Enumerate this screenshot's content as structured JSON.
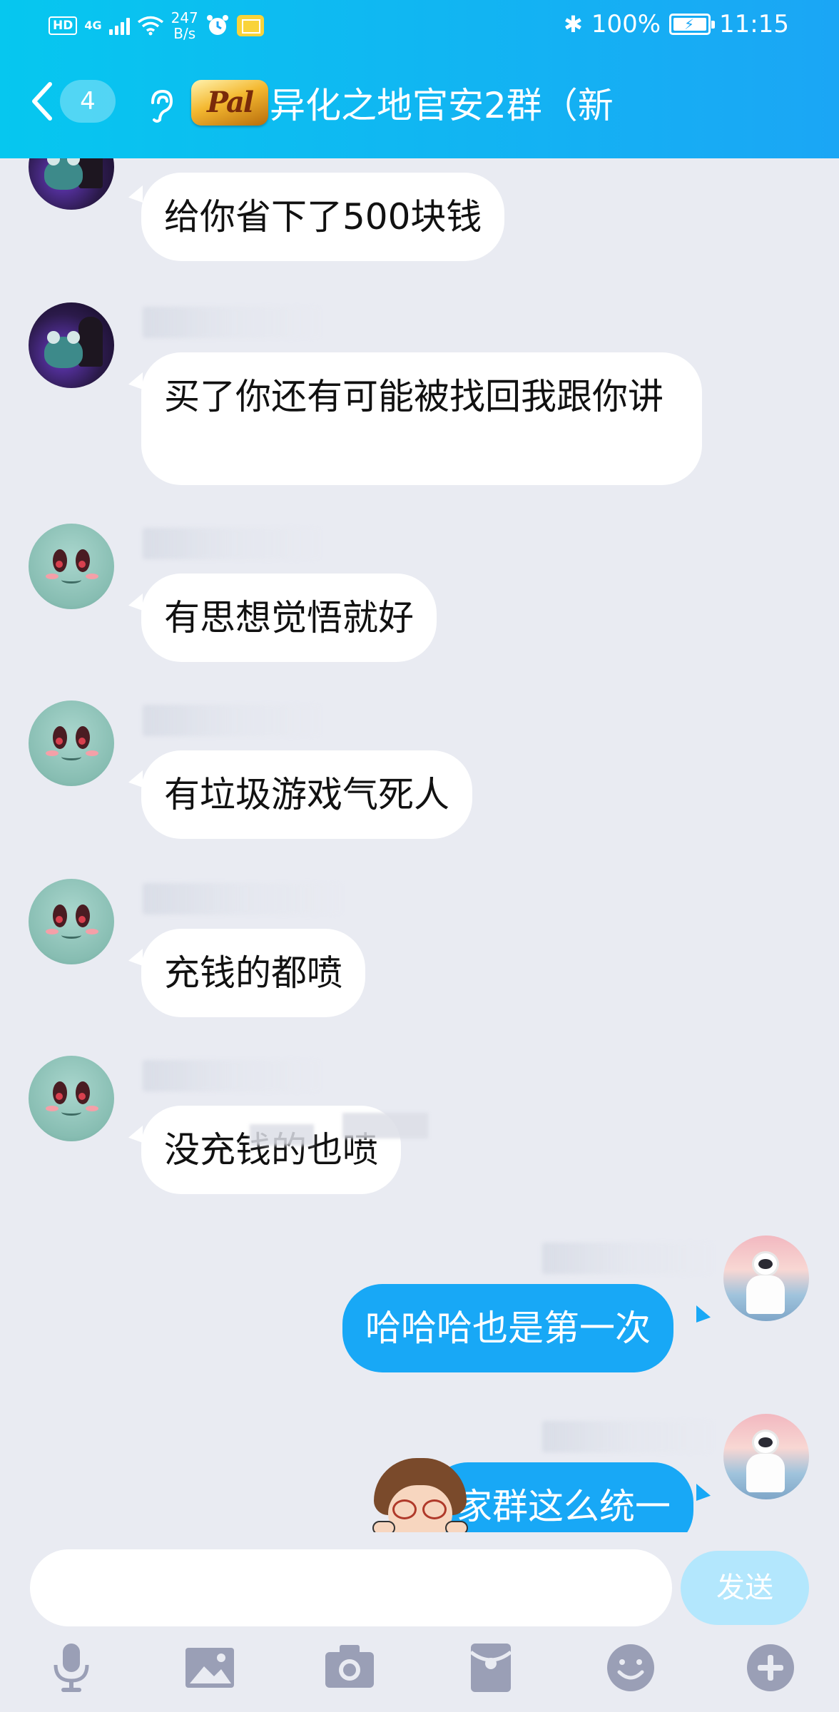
{
  "status_bar": {
    "hd": "HD",
    "net_type": "4G",
    "net_speed_value": "247",
    "net_speed_unit": "B/s",
    "battery_pct": "100%",
    "time": "11:15"
  },
  "nav": {
    "unread_count": "4",
    "group_logo_text": "Pal",
    "group_title": "异化之地官安2群（新"
  },
  "messages": [
    {
      "text": "给你省下了500块钱",
      "from": "other",
      "avatar": "dark-frog-avatar"
    },
    {
      "text": "买了你还有可能被找回我跟你讲",
      "from": "other",
      "avatar": "dark-frog-avatar"
    },
    {
      "text": "有思想觉悟就好",
      "from": "other",
      "avatar": "squirtle-avatar"
    },
    {
      "text": "有垃圾游戏气死人",
      "from": "other",
      "avatar": "squirtle-avatar"
    },
    {
      "text": "充钱的都喷",
      "from": "other",
      "avatar": "squirtle-avatar"
    },
    {
      "text": "没充钱的也喷",
      "from": "other",
      "avatar": "squirtle-avatar"
    },
    {
      "text": "哈哈哈也是第一次",
      "from": "self",
      "avatar": "astronaut-avatar"
    },
    {
      "text": "家群这么统一",
      "from": "self",
      "avatar": "astronaut-avatar"
    }
  ],
  "input": {
    "value": "",
    "send_label": "发送"
  },
  "toolbar": [
    "mic-icon",
    "image-icon",
    "camera-icon",
    "red-packet-icon",
    "emoji-icon",
    "plus-icon"
  ],
  "colors": {
    "header_start": "#06c7ef",
    "header_end": "#1ba6f5",
    "self_bubble": "#18a8f6",
    "chat_bg": "#e9ebf2",
    "send_disabled": "#b3e7fd",
    "toolbar_icon": "#9a9fb6"
  }
}
